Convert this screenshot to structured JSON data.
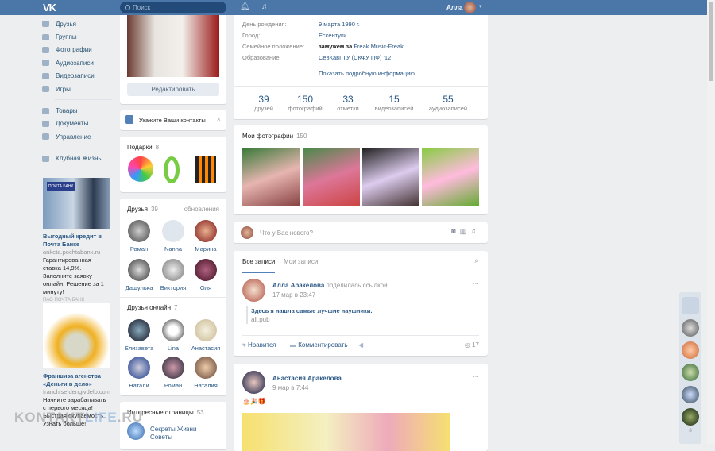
{
  "header": {
    "logo": "VK",
    "search_placeholder": "Поиск",
    "user_name": "Алла"
  },
  "nav": {
    "items": [
      {
        "label": "Друзья"
      },
      {
        "label": "Группы"
      },
      {
        "label": "Фотографии"
      },
      {
        "label": "Аудиозаписи"
      },
      {
        "label": "Видеозаписи"
      },
      {
        "label": "Игры"
      }
    ],
    "items2": [
      {
        "label": "Товары"
      },
      {
        "label": "Документы"
      },
      {
        "label": "Управление"
      }
    ],
    "items3": [
      {
        "label": "Клубная Жизнь"
      }
    ]
  },
  "ads": [
    {
      "logo": "ПОЧТА БАНК",
      "title": "Выгодный кредит в Почта Банке",
      "url": "anketa.pochtabank.ru",
      "desc": "Гарантированная ставка 14,9%. Заполните заявку онлайн. Решение за 1 минуту!",
      "sponsor": "ПАО ПОЧТА БАНК"
    },
    {
      "title": "Франшиза агенства «Деньги в дело»",
      "url": "franchise.dengivdelo.com",
      "desc": "Начните зарабатывать с первого месяца! Быстрая окупаемость. Узнать больше!"
    }
  ],
  "profile": {
    "edit_button": "Редактировать",
    "contacts_prompt": "Укажите Ваши контакты",
    "info": [
      {
        "label": "День рождения:",
        "value": "9 марта 1990 г."
      },
      {
        "label": "Город:",
        "value": "Ессентуки"
      },
      {
        "label": "Семейное положение:",
        "value_bold": "замужем за",
        "value": "Freak Music-Freak"
      },
      {
        "label": "Образование:",
        "value": "СевКавГТУ (СКФУ ПФ) '12"
      }
    ],
    "show_more": "Показать подробную информацию",
    "counters": [
      {
        "n": "39",
        "l": "друзей"
      },
      {
        "n": "150",
        "l": "фотографий"
      },
      {
        "n": "33",
        "l": "отметки"
      },
      {
        "n": "15",
        "l": "видеозаписей"
      },
      {
        "n": "55",
        "l": "аудиозаписей"
      }
    ]
  },
  "gifts": {
    "title": "Подарки",
    "count": "8"
  },
  "friends": {
    "title": "Друзья",
    "count": "39",
    "updates": "обновления",
    "list": [
      "Роман",
      "Nanna",
      "Марина",
      "Дашулька",
      "Виктория",
      "Оля"
    ]
  },
  "online": {
    "title": "Друзья онлайн",
    "count": "7",
    "list": [
      "Елизавета",
      "Lina",
      "Анастасия",
      "Натали",
      "Роман",
      "Наталия"
    ]
  },
  "pages": {
    "title": "Интересные страницы",
    "count": "53",
    "first": "Секреты Жизни | Советы"
  },
  "photos": {
    "title": "Мои фотографии",
    "count": "150"
  },
  "composer": {
    "placeholder": "Что у Вас нового?"
  },
  "wall": {
    "tabs": [
      "Все записи",
      "Мои записи"
    ],
    "posts": [
      {
        "author": "Алла Аракелова",
        "action": "поделилась ссылкой",
        "time": "17 мар в 23:47",
        "text": "Здесь я нашла самые лучшие наушники.",
        "link": "ali.pub",
        "like": "Нравится",
        "comment": "Комментировать",
        "views": "17"
      },
      {
        "author": "Анастасия Аракелова",
        "time": "9 мар в 7:44"
      }
    ]
  },
  "watermark": {
    "a": "KONTAKT",
    "b": "LIFE",
    "c": ".RU"
  },
  "right_bar": {
    "count": "8"
  }
}
